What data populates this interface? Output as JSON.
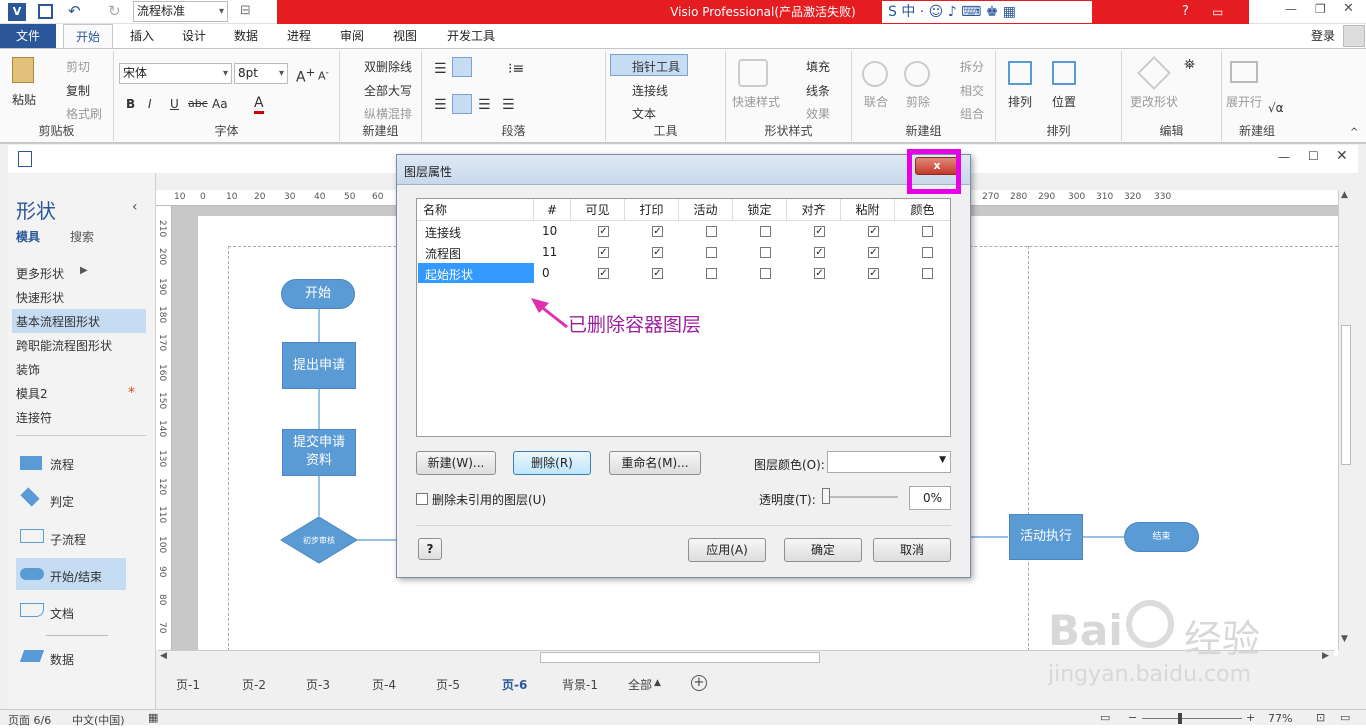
{
  "app": {
    "style_combo": "流程标准",
    "window_title": "Visio Professional(产品激活失败)",
    "login": "登录",
    "tabs": [
      "文件",
      "开始",
      "插入",
      "设计",
      "数据",
      "进程",
      "审阅",
      "视图",
      "开发工具"
    ]
  },
  "ribbon": {
    "clipboard": {
      "paste": "粘贴",
      "cut": "剪切",
      "copy": "复制",
      "format_painter": "格式刷",
      "label": "剪贴板"
    },
    "font": {
      "name": "宋体",
      "size": "8pt",
      "bold": "B",
      "italic": "I",
      "underline": "U",
      "strike": "abc",
      "aa": "Aa",
      "color": "A",
      "label": "字体"
    },
    "newgroup1": {
      "double_strike": "双删除线",
      "all_caps": "全部大写",
      "vertical": "纵横混排",
      "label": "新建组"
    },
    "paragraph": {
      "label": "段落"
    },
    "tools": {
      "pointer": "指针工具",
      "connector": "连接线",
      "text": "文本",
      "label": "工具"
    },
    "shape_style": {
      "quick": "快速样式",
      "fill": "填充",
      "line": "线条",
      "effect": "效果",
      "label": "形状样式"
    },
    "newgroup2": {
      "union": "联合",
      "trim": "剪除",
      "split": "拆分",
      "intersect": "相交",
      "combine": "组合",
      "label": "新建组"
    },
    "arrange": {
      "arrange": "排列",
      "position": "位置",
      "label": "排列"
    },
    "edit": {
      "change_shape": "更改形状",
      "label": "编辑"
    },
    "newgroup3": {
      "expand": "展开行",
      "label": "新建组"
    }
  },
  "shapes_panel": {
    "title": "形状",
    "tab_stencils": "模具",
    "tab_search": "搜索",
    "categories": [
      "更多形状",
      "快速形状",
      "基本流程图形状",
      "跨职能流程图形状",
      "装饰",
      "模具2",
      "连接符"
    ],
    "items": [
      "流程",
      "判定",
      "子流程",
      "开始/结束",
      "文档",
      "数据"
    ]
  },
  "rulers": {
    "h_left": [
      "10",
      "0",
      "10",
      "20",
      "30",
      "40",
      "50",
      "60"
    ],
    "h_right": [
      "270",
      "280",
      "290",
      "300",
      "310",
      "320",
      "330"
    ],
    "v": [
      "210",
      "200",
      "190",
      "180",
      "170",
      "160",
      "150",
      "140",
      "130",
      "120",
      "110",
      "100",
      "90",
      "80",
      "70"
    ]
  },
  "flowchart": {
    "start": "开始",
    "submit": "提出申请",
    "materials": "提交申请资料",
    "review": "初步审核",
    "execute": "活动执行",
    "end": "结束"
  },
  "dialog": {
    "title": "图层属性",
    "close": "x",
    "columns": [
      "名称",
      "#",
      "可见",
      "打印",
      "活动",
      "锁定",
      "对齐",
      "粘附",
      "颜色"
    ],
    "rows": [
      {
        "name": "连接线",
        "count": "10",
        "checks": [
          true,
          true,
          false,
          false,
          true,
          true,
          false
        ]
      },
      {
        "name": "流程图",
        "count": "11",
        "checks": [
          true,
          true,
          false,
          false,
          true,
          true,
          false
        ]
      },
      {
        "name": "起始形状",
        "count": "0",
        "checks": [
          true,
          true,
          false,
          false,
          true,
          true,
          false
        ]
      }
    ],
    "annotation": "已删除容器图层",
    "btn_new": "新建(W)...",
    "btn_delete": "删除(R)",
    "btn_rename": "重命名(M)...",
    "layer_color_label": "图层颜色(O):",
    "remove_unref": "删除未引用的图层(U)",
    "transparency_label": "透明度(T):",
    "transparency_value": "0%",
    "help": "?",
    "btn_apply": "应用(A)",
    "btn_ok": "确定",
    "btn_cancel": "取消"
  },
  "page_tabs": [
    "页-1",
    "页-2",
    "页-3",
    "页-4",
    "页-5",
    "页-6",
    "背景-1",
    "全部"
  ],
  "status": {
    "page": "页面 6/6",
    "lang": "中文(中国)",
    "zoom": "77%"
  },
  "watermark": {
    "brand": "Bai",
    "brand2": "经验",
    "url": "jingyan.baidu.com"
  },
  "colors": {
    "accent": "#2b579a",
    "title_red": "#e51c20",
    "shape_blue": "#5b9bd5",
    "highlight": "#e600e6",
    "annotation": "#9b1fa0"
  }
}
